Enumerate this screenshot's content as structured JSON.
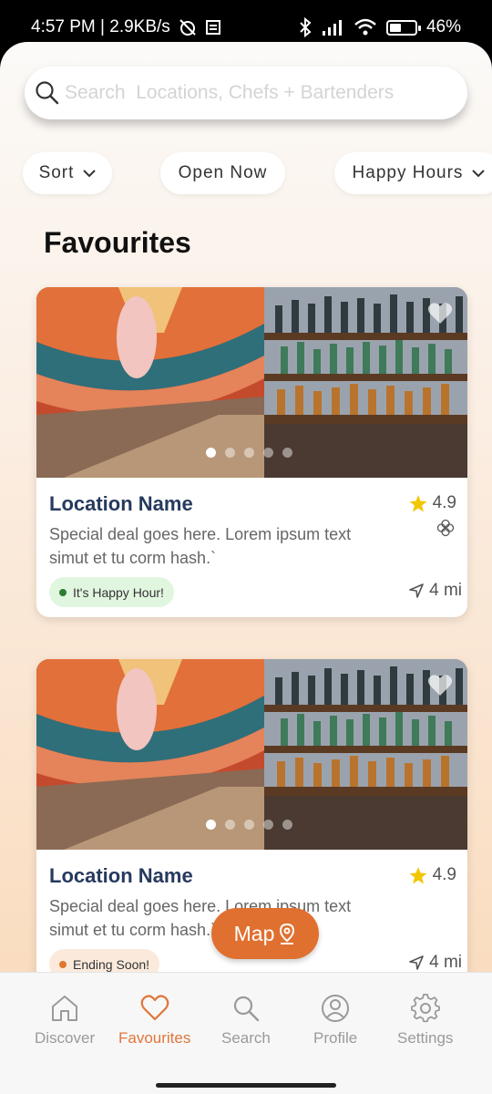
{
  "status_bar": {
    "time_speed": "4:57 PM | 2.9KB/s",
    "battery": "46%",
    "battery_level": 0.46
  },
  "search": {
    "placeholder": "Search  Locations, Chefs + Bartenders"
  },
  "filters": {
    "sort": "Sort",
    "open_now": "Open Now",
    "happy_hours": "Happy Hours"
  },
  "section_title": "Favourites",
  "cards": [
    {
      "name": "Location Name",
      "rating": "4.9",
      "description": "Special deal goes here. Lorem ipsum text simut et tu corm hash.`",
      "badge": "It's Happy Hour!",
      "distance": "4 mi",
      "badge_color": "#2e7d32"
    },
    {
      "name": "Location Name",
      "rating": "4.9",
      "description": "Special deal goes here. Lorem ipsum text simut et tu corm hash.`",
      "badge": "Ending Soon!",
      "distance": "4 mi",
      "badge_color": "#e0772f"
    }
  ],
  "map_button": "Map",
  "nav": {
    "discover": "Discover",
    "favourites": "Favourites",
    "search": "Search",
    "profile": "Profile",
    "settings": "Settings"
  },
  "colors": {
    "accent": "#e0763b",
    "title_blue": "#263a5e",
    "star": "#f2c600"
  }
}
